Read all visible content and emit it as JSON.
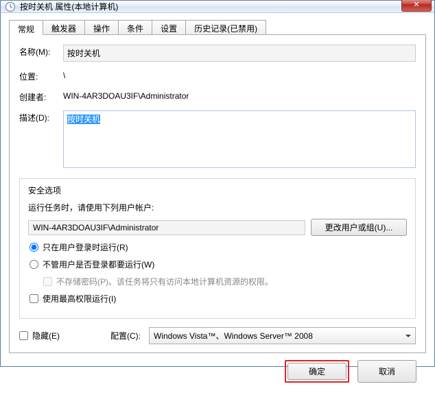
{
  "window": {
    "title": "按时关机 属性(本地计算机)",
    "close_glyph": "✕"
  },
  "tabs": {
    "general": "常规",
    "triggers": "触发器",
    "actions": "操作",
    "conditions": "条件",
    "settings": "设置",
    "history": "历史记录(已禁用)"
  },
  "general": {
    "name_label": "名称(M):",
    "name_value": "按时关机",
    "location_label": "位置:",
    "location_value": "\\",
    "author_label": "创建者:",
    "author_value": "WIN-4AR3DOAU3IF\\Administrator",
    "desc_label": "描述(D):",
    "desc_value": "按时关机"
  },
  "security": {
    "legend": "安全选项",
    "run_as_label": "运行任务时，请使用下列用户帐户:",
    "run_as_user": "WIN-4AR3DOAU3IF\\Administrator",
    "change_user_btn": "更改用户或组(U)...",
    "radio_loggedon": "只在用户登录时运行(R)",
    "radio_anytime": "不管用户是否登录都要运行(W)",
    "nostore_pw": "不存储密码(P)。该任务将只有访问本地计算机资源的权限。",
    "highest_priv": "使用最高权限运行(I)"
  },
  "bottom": {
    "hidden_label": "隐藏(E)",
    "configure_label": "配置(C):",
    "configure_value": "Windows Vista™、Windows Server™ 2008"
  },
  "buttons": {
    "ok": "确定",
    "cancel": "取消"
  }
}
